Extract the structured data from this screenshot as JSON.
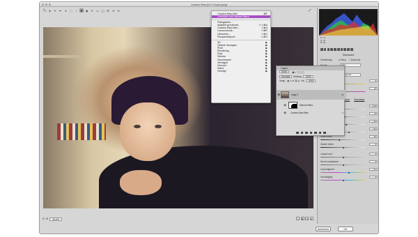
{
  "window": {
    "title": "Camera Raw (Do 3 kopie.jpeg)"
  },
  "toolbar": {
    "tools": [
      "zoom-tool",
      "hand-tool",
      "white-balance-tool",
      "color-sampler-tool",
      "targeted-adjust-tool",
      "crop-tool",
      "straighten-tool",
      "spot-removal-tool",
      "red-eye-tool",
      "adjustment-brush-tool",
      "graduated-filter-tool",
      "radial-filter-tool",
      "preferences-tool",
      "rotate-left-tool",
      "rotate-right-tool"
    ]
  },
  "statusbar": {
    "zoom": "35,6%"
  },
  "histogram": {
    "r": "R: 47",
    "g": "G: 47",
    "b": "B: 39"
  },
  "panel": {
    "title": "Standaard",
    "treatment_label": "Verwerking:",
    "treatment_color": "Kleur",
    "treatment_bw": "Zwart-wit",
    "profile_label": "Profiel:",
    "profile_value": "Kleur",
    "wb_label": "Witbalans:",
    "wb_value": "Aangepast",
    "temp_label": "Temperatuur",
    "temp_value": "0",
    "tint_label": "Kleur",
    "tint_value": "+8",
    "auto_label": "Automatisch",
    "default_label": "Standaard",
    "sliders": [
      {
        "label": "Belichting",
        "value": "0,00"
      },
      {
        "label": "Contrast",
        "value": "+5"
      },
      {
        "label": "Hooglichten",
        "value": "+13"
      },
      {
        "label": "Schaduwen",
        "value": "+34"
      },
      {
        "label": "Witte tinten",
        "value": "-35"
      },
      {
        "label": "Zwarte tinten",
        "value": "0"
      },
      {
        "label": "Lokaal cont.",
        "value": "0"
      },
      {
        "label": "Nevel verwijderen",
        "value": "0"
      },
      {
        "label": "Levendigheid",
        "value": "+27"
      },
      {
        "label": "Verzadiging",
        "value": "0"
      }
    ]
  },
  "menu": {
    "items": [
      {
        "label": "Camera Raw-filter",
        "shortcut": "⌘F",
        "type": "item"
      },
      {
        "label": "Omzetten voor slimme filters",
        "shortcut": "",
        "type": "item",
        "highlight": true
      },
      {
        "type": "sep"
      },
      {
        "label": "Filtergalerie...",
        "shortcut": "",
        "type": "item"
      },
      {
        "label": "Adaptief groothoek...",
        "shortcut": "⌥⇧⌘A",
        "type": "item"
      },
      {
        "label": "Camera Raw-filter...",
        "shortcut": "⇧⌘A",
        "type": "item"
      },
      {
        "label": "Lenscorrectie...",
        "shortcut": "⇧⌘R",
        "type": "item"
      },
      {
        "label": "Uitvloeien...",
        "shortcut": "⇧⌘X",
        "type": "item"
      },
      {
        "label": "Perspectiefpunt...",
        "shortcut": "⌥⌘V",
        "type": "item"
      },
      {
        "type": "sep"
      },
      {
        "label": "3D",
        "shortcut": "▶",
        "type": "item"
      },
      {
        "label": "Galerie Vervagen",
        "shortcut": "▶",
        "type": "item"
      },
      {
        "label": "Pixel",
        "shortcut": "▶",
        "type": "item"
      },
      {
        "label": "Rendering",
        "shortcut": "▶",
        "type": "item"
      },
      {
        "label": "Ruis",
        "shortcut": "▶",
        "type": "item"
      },
      {
        "label": "Stileren",
        "shortcut": "▶",
        "type": "item"
      },
      {
        "label": "Verscherpen",
        "shortcut": "▶",
        "type": "item"
      },
      {
        "label": "Vervagen",
        "shortcut": "▶",
        "type": "item"
      },
      {
        "label": "Vervorm",
        "shortcut": "▶",
        "type": "item"
      },
      {
        "label": "Video",
        "shortcut": "▶",
        "type": "item"
      },
      {
        "label": "Overige",
        "shortcut": "▶",
        "type": "item"
      }
    ]
  },
  "layers": {
    "title": "Lagen",
    "search": "Soort",
    "blend": "Normaal",
    "opacity_label": "Dekking:",
    "opacity_value": "100%",
    "lock_label": "Vergr.:",
    "fill_label": "Vul:",
    "fill_value": "100%",
    "layer1": "Laag 0",
    "smartfilters": "Slimme filters",
    "filter": "Camera Raw-filter"
  },
  "buttons": {
    "cancel": "Annuleren",
    "ok": "OK"
  }
}
